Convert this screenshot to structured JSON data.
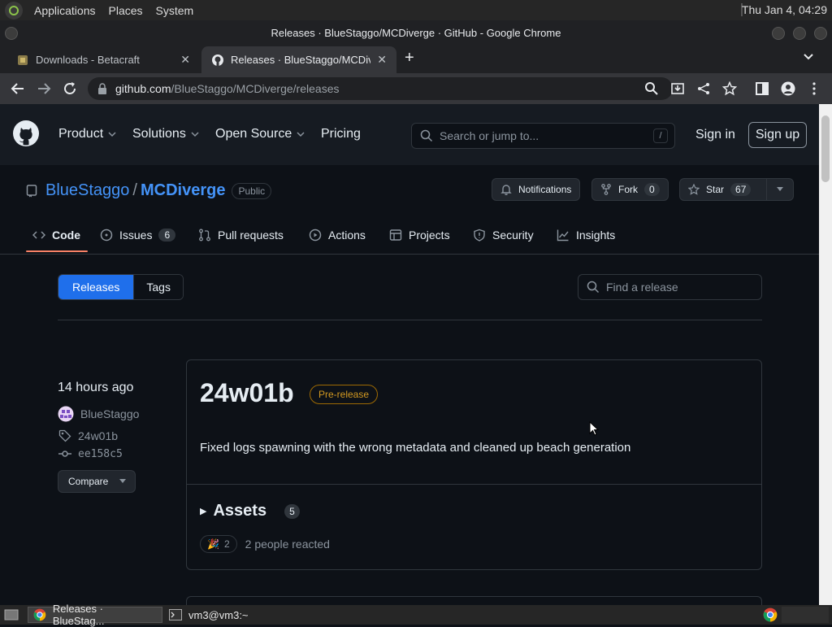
{
  "os": {
    "menus": [
      "Applications",
      "Places",
      "System"
    ],
    "clock": "Thu Jan  4, 04:29"
  },
  "window": {
    "title": "Releases · BlueStaggo/MCDiverge · GitHub - Google Chrome"
  },
  "tabs": [
    {
      "label": "Downloads - Betacraft",
      "close": "✕"
    },
    {
      "label": "Releases · BlueStaggo/MCDiv",
      "close": "✕"
    }
  ],
  "url": {
    "host": "github.com",
    "path": "/BlueStaggo/MCDiverge/releases"
  },
  "header": {
    "nav": [
      "Product",
      "Solutions",
      "Open Source",
      "Pricing"
    ],
    "search_placeholder": "Search or jump to...",
    "search_key": "/",
    "signin": "Sign in",
    "signup": "Sign up"
  },
  "repo": {
    "owner": "BlueStaggo",
    "sep": "/",
    "name": "MCDiverge",
    "visibility": "Public",
    "notifications": "Notifications",
    "fork_label": "Fork",
    "fork_count": "0",
    "star_label": "Star",
    "star_count": "67",
    "tabs": [
      {
        "label": "Code"
      },
      {
        "label": "Issues",
        "count": "6"
      },
      {
        "label": "Pull requests"
      },
      {
        "label": "Actions"
      },
      {
        "label": "Projects"
      },
      {
        "label": "Security"
      },
      {
        "label": "Insights"
      }
    ]
  },
  "releases_page": {
    "seg_releases": "Releases",
    "seg_tags": "Tags",
    "find_placeholder": "Find a release"
  },
  "release": {
    "time": "14 hours ago",
    "author": "BlueStaggo",
    "tag": "24w01b",
    "commit": "ee158c5",
    "compare": "Compare",
    "version": "24w01b",
    "badge": "Pre-release",
    "description": "Fixed logs spawning with the wrong metadata and cleaned up beach generation",
    "assets_label": "Assets",
    "assets_count": "5",
    "reaction_emoji": "🎉",
    "reaction_count": "2",
    "reaction_text": "2 people reacted"
  },
  "taskbar": {
    "items": [
      "Releases · BlueStag...",
      "vm3@vm3:~"
    ]
  },
  "colors": {
    "accent": "#1f6feb",
    "link": "#4493f8",
    "prerelease": "#d29922",
    "underline": "#f78166"
  }
}
